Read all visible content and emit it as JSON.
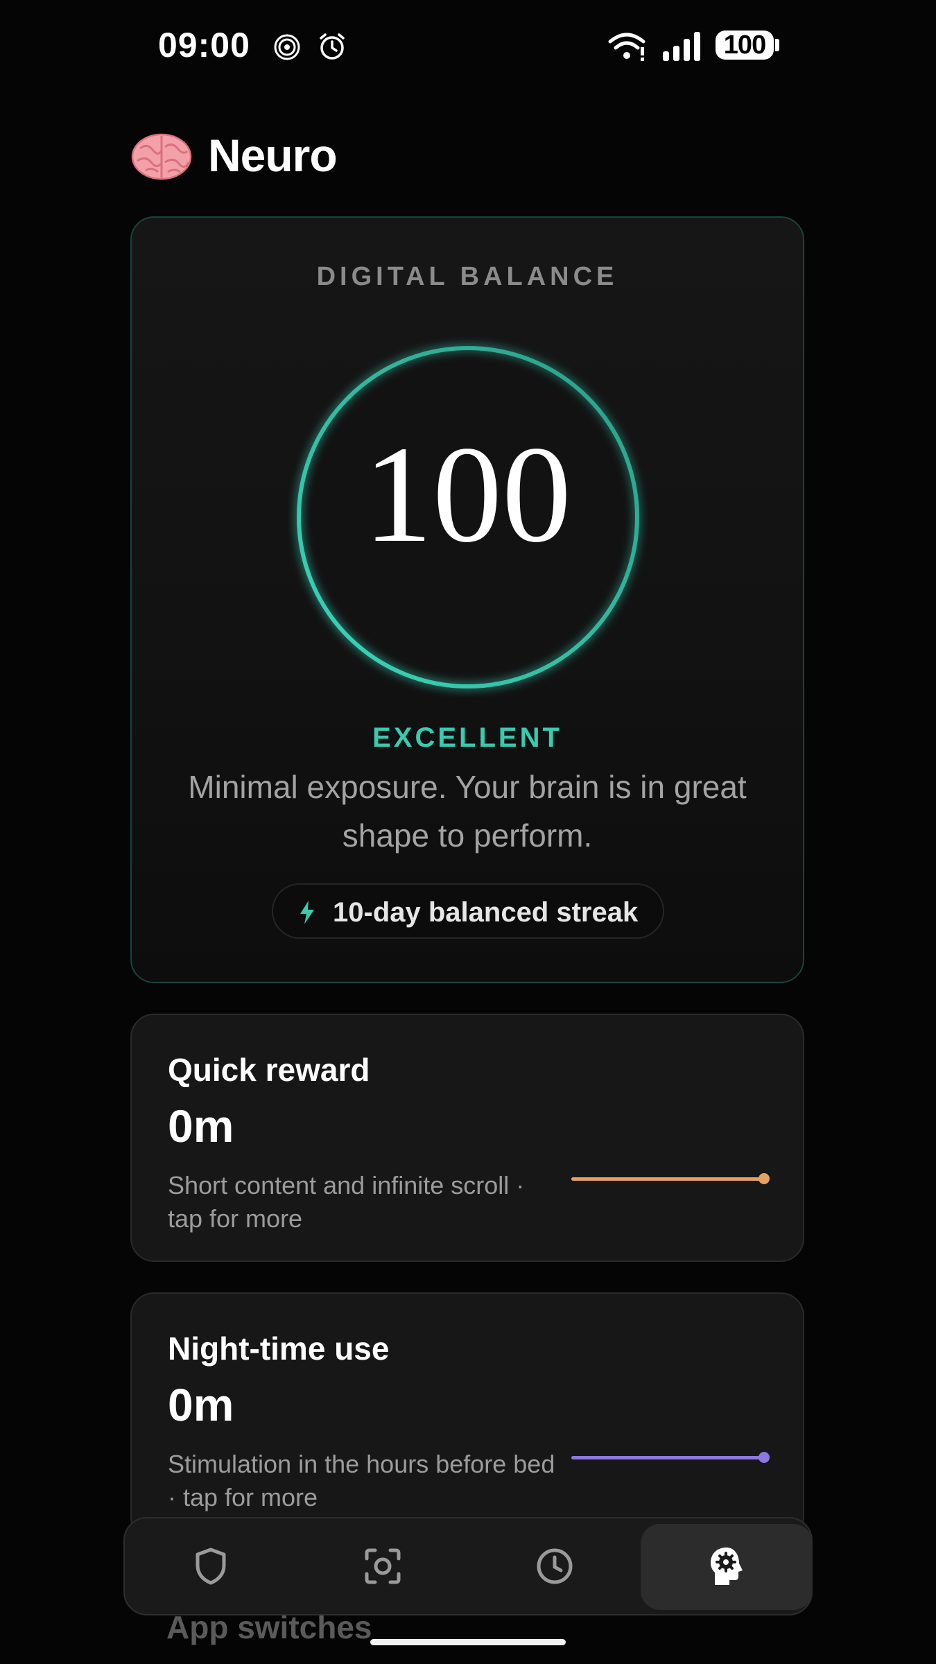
{
  "status_bar": {
    "time": "09:00",
    "battery": "100",
    "left_icons": [
      "hotspot-icon",
      "alarm-icon"
    ],
    "right_icons": [
      "wifi-icon",
      "signal-icon",
      "battery-icon"
    ]
  },
  "header": {
    "logo_icon": "brain-icon",
    "title": "Neuro"
  },
  "score_card": {
    "label": "DIGITAL BALANCE",
    "score": "100",
    "score_progress": 1.0,
    "rating": "EXCELLENT",
    "description": "Minimal exposure. Your brain is in great shape to perform.",
    "streak_icon": "lightning-icon",
    "streak_label": "10-day balanced streak"
  },
  "metrics": [
    {
      "title": "Quick reward",
      "value": "0m",
      "description": "Short content and infinite scroll · tap for more",
      "color": "#e3a263"
    },
    {
      "title": "Night-time use",
      "value": "0m",
      "description": "Stimulation in the hours before bed · tap for more",
      "color": "#8c78e0"
    }
  ],
  "partially_visible_title": "App switches",
  "nav": {
    "items": [
      {
        "icon": "shield-icon",
        "active": false
      },
      {
        "icon": "focus-scan-icon",
        "active": false
      },
      {
        "icon": "clock-icon",
        "active": false
      },
      {
        "icon": "brain-settings-icon",
        "active": true
      }
    ]
  },
  "colors": {
    "accent": "#38cbb0",
    "background": "#050505",
    "card": "#171717"
  }
}
